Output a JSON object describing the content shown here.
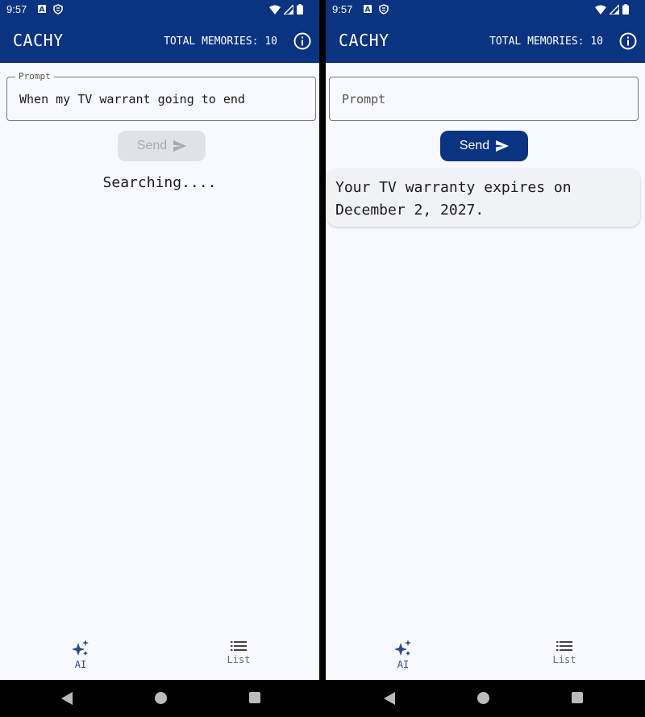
{
  "status_bar": {
    "time": "9:57"
  },
  "app_bar": {
    "title": "CACHY",
    "memories": "TOTAL MEMORIES: 10"
  },
  "left": {
    "prompt_label": "Prompt",
    "prompt_value": "When my TV warrant going to end",
    "send_label": "Send",
    "status_text": "Searching...."
  },
  "right": {
    "prompt_placeholder": "Prompt",
    "send_label": "Send",
    "answer_line1": "Your TV warranty expires on",
    "answer_line2": "December 2, 2027."
  },
  "bottom_nav": {
    "ai_label": "AI",
    "list_label": "List"
  },
  "colors": {
    "primary": "#0a3381",
    "background": "#f8f9fe",
    "disabled": "#e1e2e8"
  }
}
